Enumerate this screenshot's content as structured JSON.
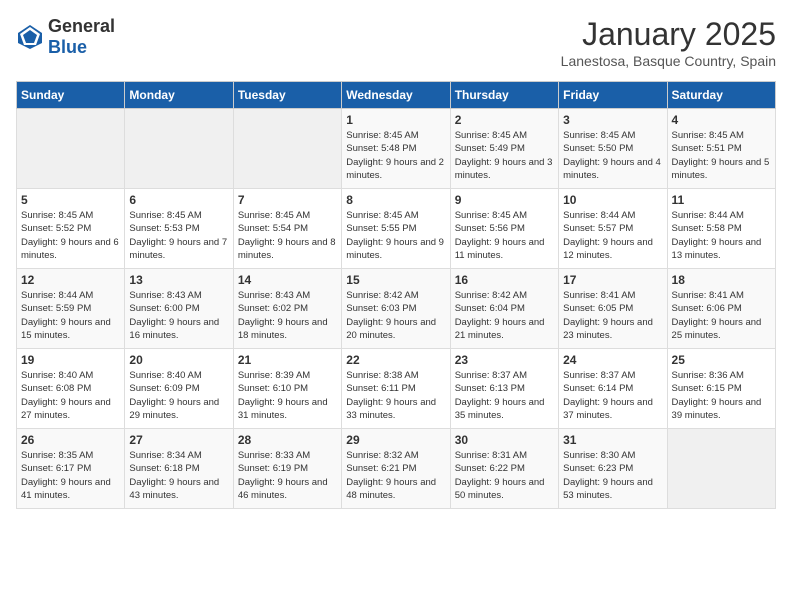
{
  "header": {
    "logo_general": "General",
    "logo_blue": "Blue",
    "title": "January 2025",
    "subtitle": "Lanestosa, Basque Country, Spain"
  },
  "calendar": {
    "days_of_week": [
      "Sunday",
      "Monday",
      "Tuesday",
      "Wednesday",
      "Thursday",
      "Friday",
      "Saturday"
    ],
    "weeks": [
      [
        {
          "day": "",
          "info": ""
        },
        {
          "day": "",
          "info": ""
        },
        {
          "day": "",
          "info": ""
        },
        {
          "day": "1",
          "info": "Sunrise: 8:45 AM\nSunset: 5:48 PM\nDaylight: 9 hours and 2 minutes."
        },
        {
          "day": "2",
          "info": "Sunrise: 8:45 AM\nSunset: 5:49 PM\nDaylight: 9 hours and 3 minutes."
        },
        {
          "day": "3",
          "info": "Sunrise: 8:45 AM\nSunset: 5:50 PM\nDaylight: 9 hours and 4 minutes."
        },
        {
          "day": "4",
          "info": "Sunrise: 8:45 AM\nSunset: 5:51 PM\nDaylight: 9 hours and 5 minutes."
        }
      ],
      [
        {
          "day": "5",
          "info": "Sunrise: 8:45 AM\nSunset: 5:52 PM\nDaylight: 9 hours and 6 minutes."
        },
        {
          "day": "6",
          "info": "Sunrise: 8:45 AM\nSunset: 5:53 PM\nDaylight: 9 hours and 7 minutes."
        },
        {
          "day": "7",
          "info": "Sunrise: 8:45 AM\nSunset: 5:54 PM\nDaylight: 9 hours and 8 minutes."
        },
        {
          "day": "8",
          "info": "Sunrise: 8:45 AM\nSunset: 5:55 PM\nDaylight: 9 hours and 9 minutes."
        },
        {
          "day": "9",
          "info": "Sunrise: 8:45 AM\nSunset: 5:56 PM\nDaylight: 9 hours and 11 minutes."
        },
        {
          "day": "10",
          "info": "Sunrise: 8:44 AM\nSunset: 5:57 PM\nDaylight: 9 hours and 12 minutes."
        },
        {
          "day": "11",
          "info": "Sunrise: 8:44 AM\nSunset: 5:58 PM\nDaylight: 9 hours and 13 minutes."
        }
      ],
      [
        {
          "day": "12",
          "info": "Sunrise: 8:44 AM\nSunset: 5:59 PM\nDaylight: 9 hours and 15 minutes."
        },
        {
          "day": "13",
          "info": "Sunrise: 8:43 AM\nSunset: 6:00 PM\nDaylight: 9 hours and 16 minutes."
        },
        {
          "day": "14",
          "info": "Sunrise: 8:43 AM\nSunset: 6:02 PM\nDaylight: 9 hours and 18 minutes."
        },
        {
          "day": "15",
          "info": "Sunrise: 8:42 AM\nSunset: 6:03 PM\nDaylight: 9 hours and 20 minutes."
        },
        {
          "day": "16",
          "info": "Sunrise: 8:42 AM\nSunset: 6:04 PM\nDaylight: 9 hours and 21 minutes."
        },
        {
          "day": "17",
          "info": "Sunrise: 8:41 AM\nSunset: 6:05 PM\nDaylight: 9 hours and 23 minutes."
        },
        {
          "day": "18",
          "info": "Sunrise: 8:41 AM\nSunset: 6:06 PM\nDaylight: 9 hours and 25 minutes."
        }
      ],
      [
        {
          "day": "19",
          "info": "Sunrise: 8:40 AM\nSunset: 6:08 PM\nDaylight: 9 hours and 27 minutes."
        },
        {
          "day": "20",
          "info": "Sunrise: 8:40 AM\nSunset: 6:09 PM\nDaylight: 9 hours and 29 minutes."
        },
        {
          "day": "21",
          "info": "Sunrise: 8:39 AM\nSunset: 6:10 PM\nDaylight: 9 hours and 31 minutes."
        },
        {
          "day": "22",
          "info": "Sunrise: 8:38 AM\nSunset: 6:11 PM\nDaylight: 9 hours and 33 minutes."
        },
        {
          "day": "23",
          "info": "Sunrise: 8:37 AM\nSunset: 6:13 PM\nDaylight: 9 hours and 35 minutes."
        },
        {
          "day": "24",
          "info": "Sunrise: 8:37 AM\nSunset: 6:14 PM\nDaylight: 9 hours and 37 minutes."
        },
        {
          "day": "25",
          "info": "Sunrise: 8:36 AM\nSunset: 6:15 PM\nDaylight: 9 hours and 39 minutes."
        }
      ],
      [
        {
          "day": "26",
          "info": "Sunrise: 8:35 AM\nSunset: 6:17 PM\nDaylight: 9 hours and 41 minutes."
        },
        {
          "day": "27",
          "info": "Sunrise: 8:34 AM\nSunset: 6:18 PM\nDaylight: 9 hours and 43 minutes."
        },
        {
          "day": "28",
          "info": "Sunrise: 8:33 AM\nSunset: 6:19 PM\nDaylight: 9 hours and 46 minutes."
        },
        {
          "day": "29",
          "info": "Sunrise: 8:32 AM\nSunset: 6:21 PM\nDaylight: 9 hours and 48 minutes."
        },
        {
          "day": "30",
          "info": "Sunrise: 8:31 AM\nSunset: 6:22 PM\nDaylight: 9 hours and 50 minutes."
        },
        {
          "day": "31",
          "info": "Sunrise: 8:30 AM\nSunset: 6:23 PM\nDaylight: 9 hours and 53 minutes."
        },
        {
          "day": "",
          "info": ""
        }
      ]
    ]
  }
}
